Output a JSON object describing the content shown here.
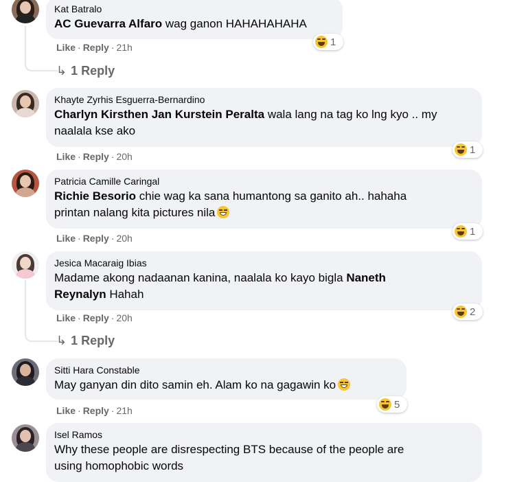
{
  "comments": [
    {
      "author": "Kat Batralo",
      "tag": "AC Guevarra Alfaro",
      "text": " wag ganon HAHAHAHAHA",
      "like": "Like",
      "reply": "Reply",
      "time": "21h",
      "reaction_count": "1",
      "replies_label": "1 Reply"
    },
    {
      "author": "Khayte Zyrhis Esguerra-Bernardino",
      "tag": "Charlyn Kirsthen Jan Kurstein Peralta",
      "text_line1": " wala lang na tag ko lng kyo .. my",
      "text_line2": "naalala kse ako",
      "like": "Like",
      "reply": "Reply",
      "time": "20h",
      "reaction_count": "1"
    },
    {
      "author": "Patricia Camille Caringal",
      "tag": "Richie Besorio",
      "text_line1": " chie wag ka sana humantong sa ganito ah.. hahaha",
      "text_line2": "printan nalang kita pictures nila",
      "like": "Like",
      "reply": "Reply",
      "time": "20h",
      "reaction_count": "1"
    },
    {
      "author": "Jesica Macaraig Ibias",
      "text_line1": "Madame akong nadaanan kanina, naalala ko kayo bigla ",
      "tag_part1": "Naneth",
      "tag_part2": "Reynalyn",
      "text_line2_rest": " Hahah",
      "like": "Like",
      "reply": "Reply",
      "time": "20h",
      "reaction_count": "2",
      "replies_label": "1 Reply"
    },
    {
      "author": "Sitti Hara Constable",
      "text": "May ganyan din dito samin eh. Alam ko na gagawin ko",
      "like": "Like",
      "reply": "Reply",
      "time": "21h",
      "reaction_count": "5"
    },
    {
      "author": "Isel Ramos",
      "text_line1": "Why these people are disrespecting BTS because of the people are",
      "text_line2": "using homophobic words"
    }
  ],
  "separator": "·",
  "reply_arrow": "↳",
  "icons": {
    "reaction": "haha-reaction-icon",
    "reply_arrow": "reply-arrow-icon",
    "inline_emoji": "laughing-emoji-icon"
  },
  "colors": {
    "bubble": "#f0f2f5",
    "meta_text": "#65676b",
    "haha_yellow": "#f7c531"
  }
}
